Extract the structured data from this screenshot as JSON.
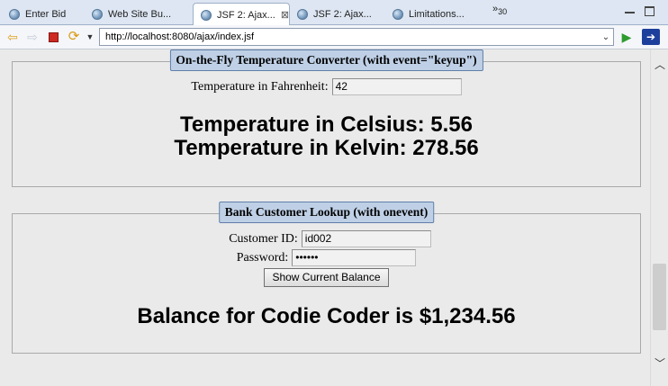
{
  "tabs": [
    {
      "label": "Enter Bid",
      "active": false
    },
    {
      "label": "Web Site Bu...",
      "active": false
    },
    {
      "label": "JSF 2: Ajax...",
      "active": true,
      "close_icon": "close-icon"
    },
    {
      "label": "JSF 2: Ajax...",
      "active": false
    },
    {
      "label": "Limitations...",
      "active": false
    }
  ],
  "tab_overflow": {
    "glyph": "»",
    "count": "30"
  },
  "toolbar": {
    "url": "http://localhost:8080/ajax/index.jsf",
    "icons": [
      "back-icon",
      "forward-icon",
      "stop-icon",
      "refresh-icon",
      "dropdown-icon",
      "go-icon",
      "external-browser-icon"
    ]
  },
  "temperature_panel": {
    "legend": "On-the-Fly Temperature Converter (with event=\"keyup\")",
    "fahrenheit_label": "Temperature in Fahrenheit:",
    "fahrenheit_value": "42",
    "celsius_text": "Temperature in Celsius: 5.56",
    "kelvin_text": "Temperature in Kelvin: 278.56"
  },
  "bank_panel": {
    "legend": "Bank Customer Lookup (with onevent)",
    "customer_id_label": "Customer ID:",
    "customer_id_value": "id002",
    "password_label": "Password:",
    "password_value": "••••••",
    "button_label": "Show Current Balance",
    "balance_text": "Balance for Codie Coder is $1,234.56"
  }
}
